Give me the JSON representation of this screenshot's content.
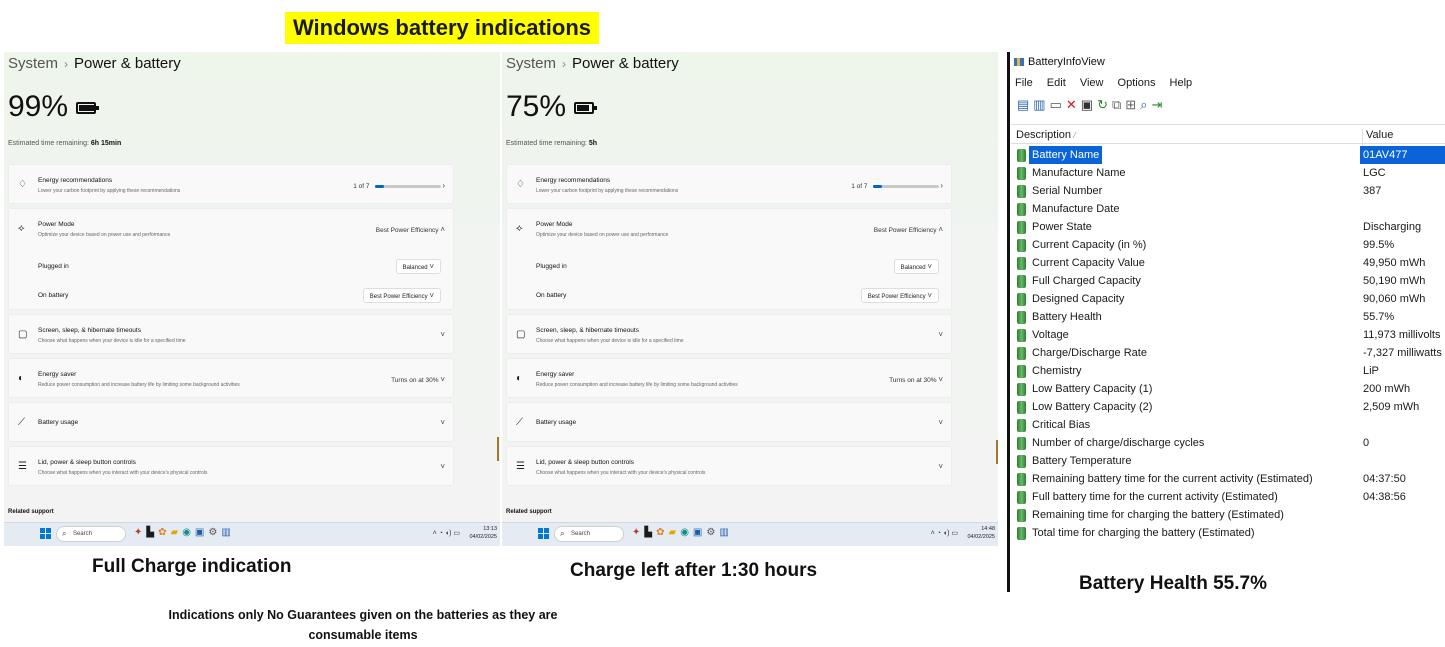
{
  "page_title": "Windows battery indications",
  "panels": [
    {
      "breadcrumb_parent": "System",
      "breadcrumb_sep": "›",
      "breadcrumb_current": "Power & battery",
      "percent": "99%",
      "battery_level": 0.99,
      "estimated_label": "Estimated time remaining:",
      "estimated_value": "6h 15min",
      "energy_rec_title": "Energy recommendations",
      "energy_rec_sub": "Lower your carbon footprint by applying these recommendations",
      "energy_rec_count": "1 of 7",
      "energy_rec_progress": 0.14,
      "power_mode_title": "Power Mode",
      "power_mode_sub": "Optimize your device based on power use and performance",
      "power_mode_value": "Best Power Efficiency",
      "plugged_in_label": "Plugged in",
      "plugged_in_value": "Balanced",
      "on_battery_label": "On battery",
      "on_battery_value": "Best Power Efficiency",
      "screen_title": "Screen, sleep, & hibernate timeouts",
      "screen_sub": "Choose what happens when your device is idle for a specified time",
      "saver_title": "Energy saver",
      "saver_sub": "Reduce power consumption and increase battery life by limiting some background activities",
      "saver_value": "Turns on at 30%",
      "usage_title": "Battery usage",
      "lid_title": "Lid, power & sleep button controls",
      "lid_sub": "Choose what happens when you interact with your device's physical controls",
      "related": "Related support",
      "search_placeholder": "Search",
      "clock_time": "13:13",
      "clock_date": "04/02/2025"
    },
    {
      "breadcrumb_parent": "System",
      "breadcrumb_sep": "›",
      "breadcrumb_current": "Power & battery",
      "percent": "75%",
      "battery_level": 0.75,
      "estimated_label": "Estimated time remaining:",
      "estimated_value": "5h",
      "energy_rec_title": "Energy recommendations",
      "energy_rec_sub": "Lower your carbon footprint by applying these recommendations",
      "energy_rec_count": "1 of 7",
      "energy_rec_progress": 0.14,
      "power_mode_title": "Power Mode",
      "power_mode_sub": "Optimize your device based on power use and performance",
      "power_mode_value": "Best Power Efficiency",
      "plugged_in_label": "Plugged in",
      "plugged_in_value": "Balanced",
      "on_battery_label": "On battery",
      "on_battery_value": "Best Power Efficiency",
      "screen_title": "Screen, sleep, & hibernate timeouts",
      "screen_sub": "Choose what happens when your device is idle for a specified time",
      "saver_title": "Energy saver",
      "saver_sub": "Reduce power consumption and increase battery life by limiting some background activities",
      "saver_value": "Turns on at 30%",
      "usage_title": "Battery usage",
      "lid_title": "Lid, power & sleep button controls",
      "lid_sub": "Choose what happens when you interact with your device's physical controls",
      "related": "Related support",
      "search_placeholder": "Search",
      "clock_time": "14:48",
      "clock_date": "04/02/2025"
    }
  ],
  "biv": {
    "title": "BatteryInfoView",
    "menu": [
      "File",
      "Edit",
      "View",
      "Options",
      "Help"
    ],
    "col_description": "Description",
    "col_value": "Value",
    "rows": [
      {
        "desc": "Battery Name",
        "val": "01AV477",
        "selected": true
      },
      {
        "desc": "Manufacture Name",
        "val": "LGC"
      },
      {
        "desc": "Serial Number",
        "val": " 387"
      },
      {
        "desc": "Manufacture Date",
        "val": ""
      },
      {
        "desc": "Power State",
        "val": "Discharging"
      },
      {
        "desc": "Current Capacity (in %)",
        "val": "99.5%"
      },
      {
        "desc": "Current Capacity Value",
        "val": "49,950 mWh"
      },
      {
        "desc": "Full Charged Capacity",
        "val": "50,190 mWh"
      },
      {
        "desc": "Designed Capacity",
        "val": "90,060 mWh"
      },
      {
        "desc": "Battery Health",
        "val": "55.7%"
      },
      {
        "desc": "Voltage",
        "val": "11,973 millivolts"
      },
      {
        "desc": "Charge/Discharge Rate",
        "val": "-7,327 milliwatts"
      },
      {
        "desc": "Chemistry",
        "val": "LiP"
      },
      {
        "desc": "Low Battery Capacity (1)",
        "val": "200 mWh"
      },
      {
        "desc": "Low Battery Capacity (2)",
        "val": "2,509 mWh"
      },
      {
        "desc": "Critical Bias",
        "val": ""
      },
      {
        "desc": "Number of charge/discharge cycles",
        "val": "0"
      },
      {
        "desc": "Battery Temperature",
        "val": ""
      },
      {
        "desc": "Remaining battery time for the current activity (Estimated)",
        "val": "04:37:50"
      },
      {
        "desc": "Full battery time for the current activity (Estimated)",
        "val": "04:38:56"
      },
      {
        "desc": "Remaining time for charging the battery (Estimated)",
        "val": ""
      },
      {
        "desc": "Total  time for charging the battery (Estimated)",
        "val": ""
      }
    ]
  },
  "captions": {
    "left": "Full Charge indication",
    "middle": "Charge left after 1:30 hours",
    "right": "Battery Health 55.7%",
    "disclaimer": "Indications only No Guarantees given on the batteries as they are consumable items"
  }
}
